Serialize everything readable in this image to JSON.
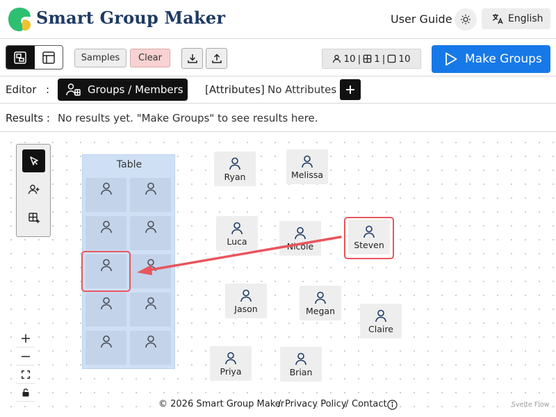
{
  "header": {
    "app_title": "Smart Group Maker",
    "user_guide_label": "User Guide",
    "language_label": "English",
    "logo_colors": [
      "#2fbf71",
      "#f2c12e"
    ]
  },
  "toolbar": {
    "samples_label": "Samples",
    "clear_label": "Clear",
    "stats": {
      "members": "10",
      "groups": "1",
      "seats": "10"
    },
    "make_groups_label": "Make Groups",
    "accent_color": "#1779e8"
  },
  "editor": {
    "label": "Editor",
    "colon": ":",
    "active_tab_label": "Groups / Members",
    "attributes_label": "[Attributes]",
    "attributes_value": "No Attributes"
  },
  "results": {
    "label": "Results :",
    "message": "No results yet. \"Make Groups\" to see results here."
  },
  "canvas": {
    "table": {
      "title": "Table"
    },
    "members": [
      "Ryan",
      "Melissa",
      "Luca",
      "Nicole",
      "Steven",
      "Jason",
      "Megan",
      "Claire",
      "Priya",
      "Brian"
    ],
    "annotation_color": "#e8555d"
  },
  "footer": {
    "copyright": "© 2026 Smart Group Maker",
    "sep1": "/",
    "privacy_label": "Privacy Policy",
    "sep2": "/",
    "contact_label": "Contact",
    "attribution": "Svelte Flow"
  }
}
